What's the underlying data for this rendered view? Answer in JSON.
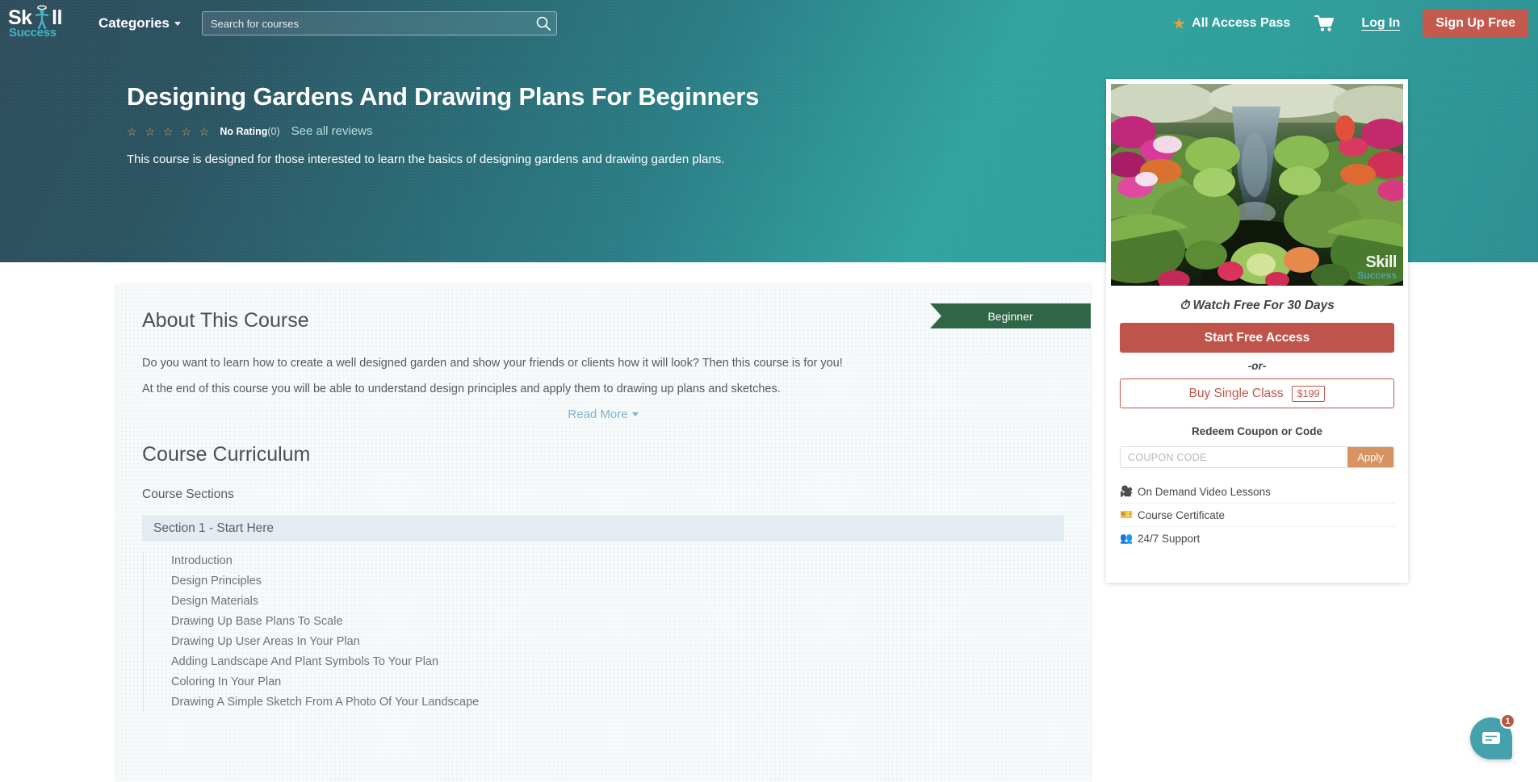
{
  "navbar": {
    "logo_sk": "Sk",
    "logo_ll": "ll",
    "logo_success": "Success",
    "categories_label": "Categories",
    "search_placeholder": "Search for courses",
    "search_value": "",
    "all_access_pass": "All Access Pass",
    "login_label": "Log In",
    "signup_label": "Sign Up Free",
    "icons": {
      "search": "search-icon",
      "cart": "cart-icon",
      "star": "star-icon",
      "chevron": "chevron-down-icon"
    }
  },
  "hero": {
    "title": "Designing Gardens And Drawing Plans For Beginners",
    "stars": "☆ ☆ ☆ ☆ ☆",
    "rating_label": "No Rating",
    "rating_count": "(0)",
    "see_reviews": "See all reviews",
    "description": "This course is designed for those interested to learn the basics of designing gardens and drawing garden plans."
  },
  "about": {
    "heading": "About This Course",
    "level_badge": "Beginner",
    "paragraph1": "Do you want to learn how to create a well designed garden and show your friends or clients how it will look? Then this course is for you!",
    "paragraph2": "At the end of this course you will be able to understand design principles and apply them to drawing up plans and sketches.",
    "read_more": "Read More"
  },
  "curriculum": {
    "heading": "Course Curriculum",
    "sections_label": "Course Sections",
    "section_title": "Section 1 - Start Here",
    "lessons": [
      "Introduction",
      "Design Principles",
      "Design Materials",
      "Drawing Up Base Plans To Scale",
      "Drawing Up User Areas In Your Plan",
      "Adding Landscape And Plant Symbols To Your Plan",
      "Coloring In Your Plan",
      "Drawing A Simple Sketch From A Photo Of Your Landscape"
    ]
  },
  "sidebar": {
    "thumbnail_watermark_top": "Skill",
    "thumbnail_watermark_bottom": "Success",
    "watch_free": "Watch Free For 30 Days",
    "start_free_access": "Start Free Access",
    "or": "-or-",
    "buy_single_class": "Buy Single Class",
    "price": "$199",
    "redeem_label": "Redeem Coupon or Code",
    "coupon_placeholder": "COUPON CODE",
    "coupon_value": "",
    "apply_label": "Apply",
    "features": [
      {
        "icon": "video-camera-icon",
        "glyph": "🎥",
        "label": "On Demand Video Lessons"
      },
      {
        "icon": "certificate-icon",
        "glyph": "🎫",
        "label": "Course Certificate"
      },
      {
        "icon": "support-people-icon",
        "glyph": "👥",
        "label": "24/7 Support"
      }
    ]
  },
  "chat": {
    "badge_count": "1",
    "icon": "chat-bubble-icon"
  },
  "colors": {
    "brand_teal": "#2f9f9c",
    "accent_red": "#c45a4e",
    "badge_green": "#2e6647",
    "apply_orange": "#d79461",
    "star_gold": "#d9a441",
    "link_blue": "#7fb4c9"
  }
}
